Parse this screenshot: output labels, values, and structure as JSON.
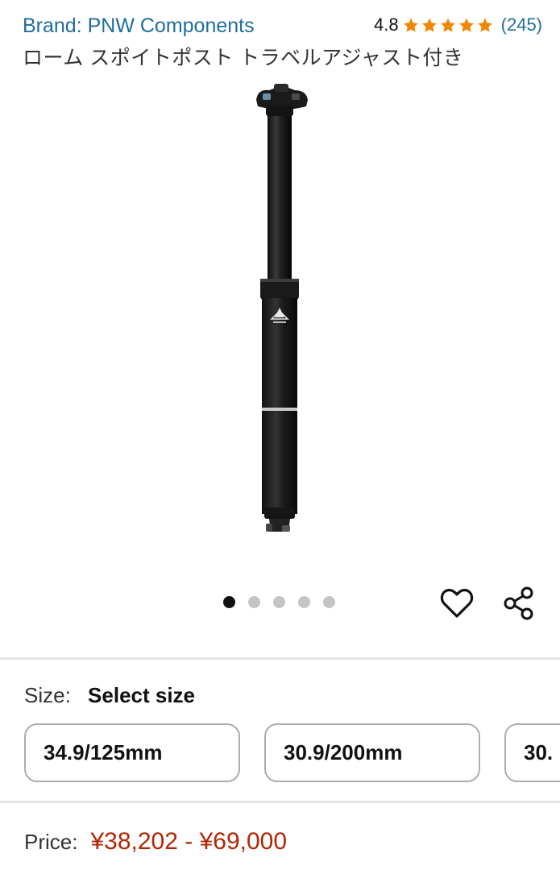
{
  "header": {
    "brand_link": "Brand: PNW Components",
    "rating_value": "4.8",
    "rating_stars": 5,
    "review_count": "(245)",
    "star_color": "#f08804"
  },
  "product": {
    "title": "ローム スポイトポスト トラベルアジャスト付き",
    "image_alt": "dropper seatpost product image"
  },
  "carousel": {
    "total_images": 5,
    "active_index": 0
  },
  "actions": {
    "wishlist_icon": "heart-icon",
    "share_icon": "share-icon"
  },
  "size": {
    "label": "Size:",
    "selected": "Select size",
    "options": [
      "34.9/125mm",
      "30.9/200mm",
      "30."
    ]
  },
  "price": {
    "label": "Price:",
    "value": "¥38,202 - ¥69,000",
    "color": "#b12704"
  },
  "colors": {
    "link": "#1f6e9b",
    "divider": "#e3e6e6"
  }
}
